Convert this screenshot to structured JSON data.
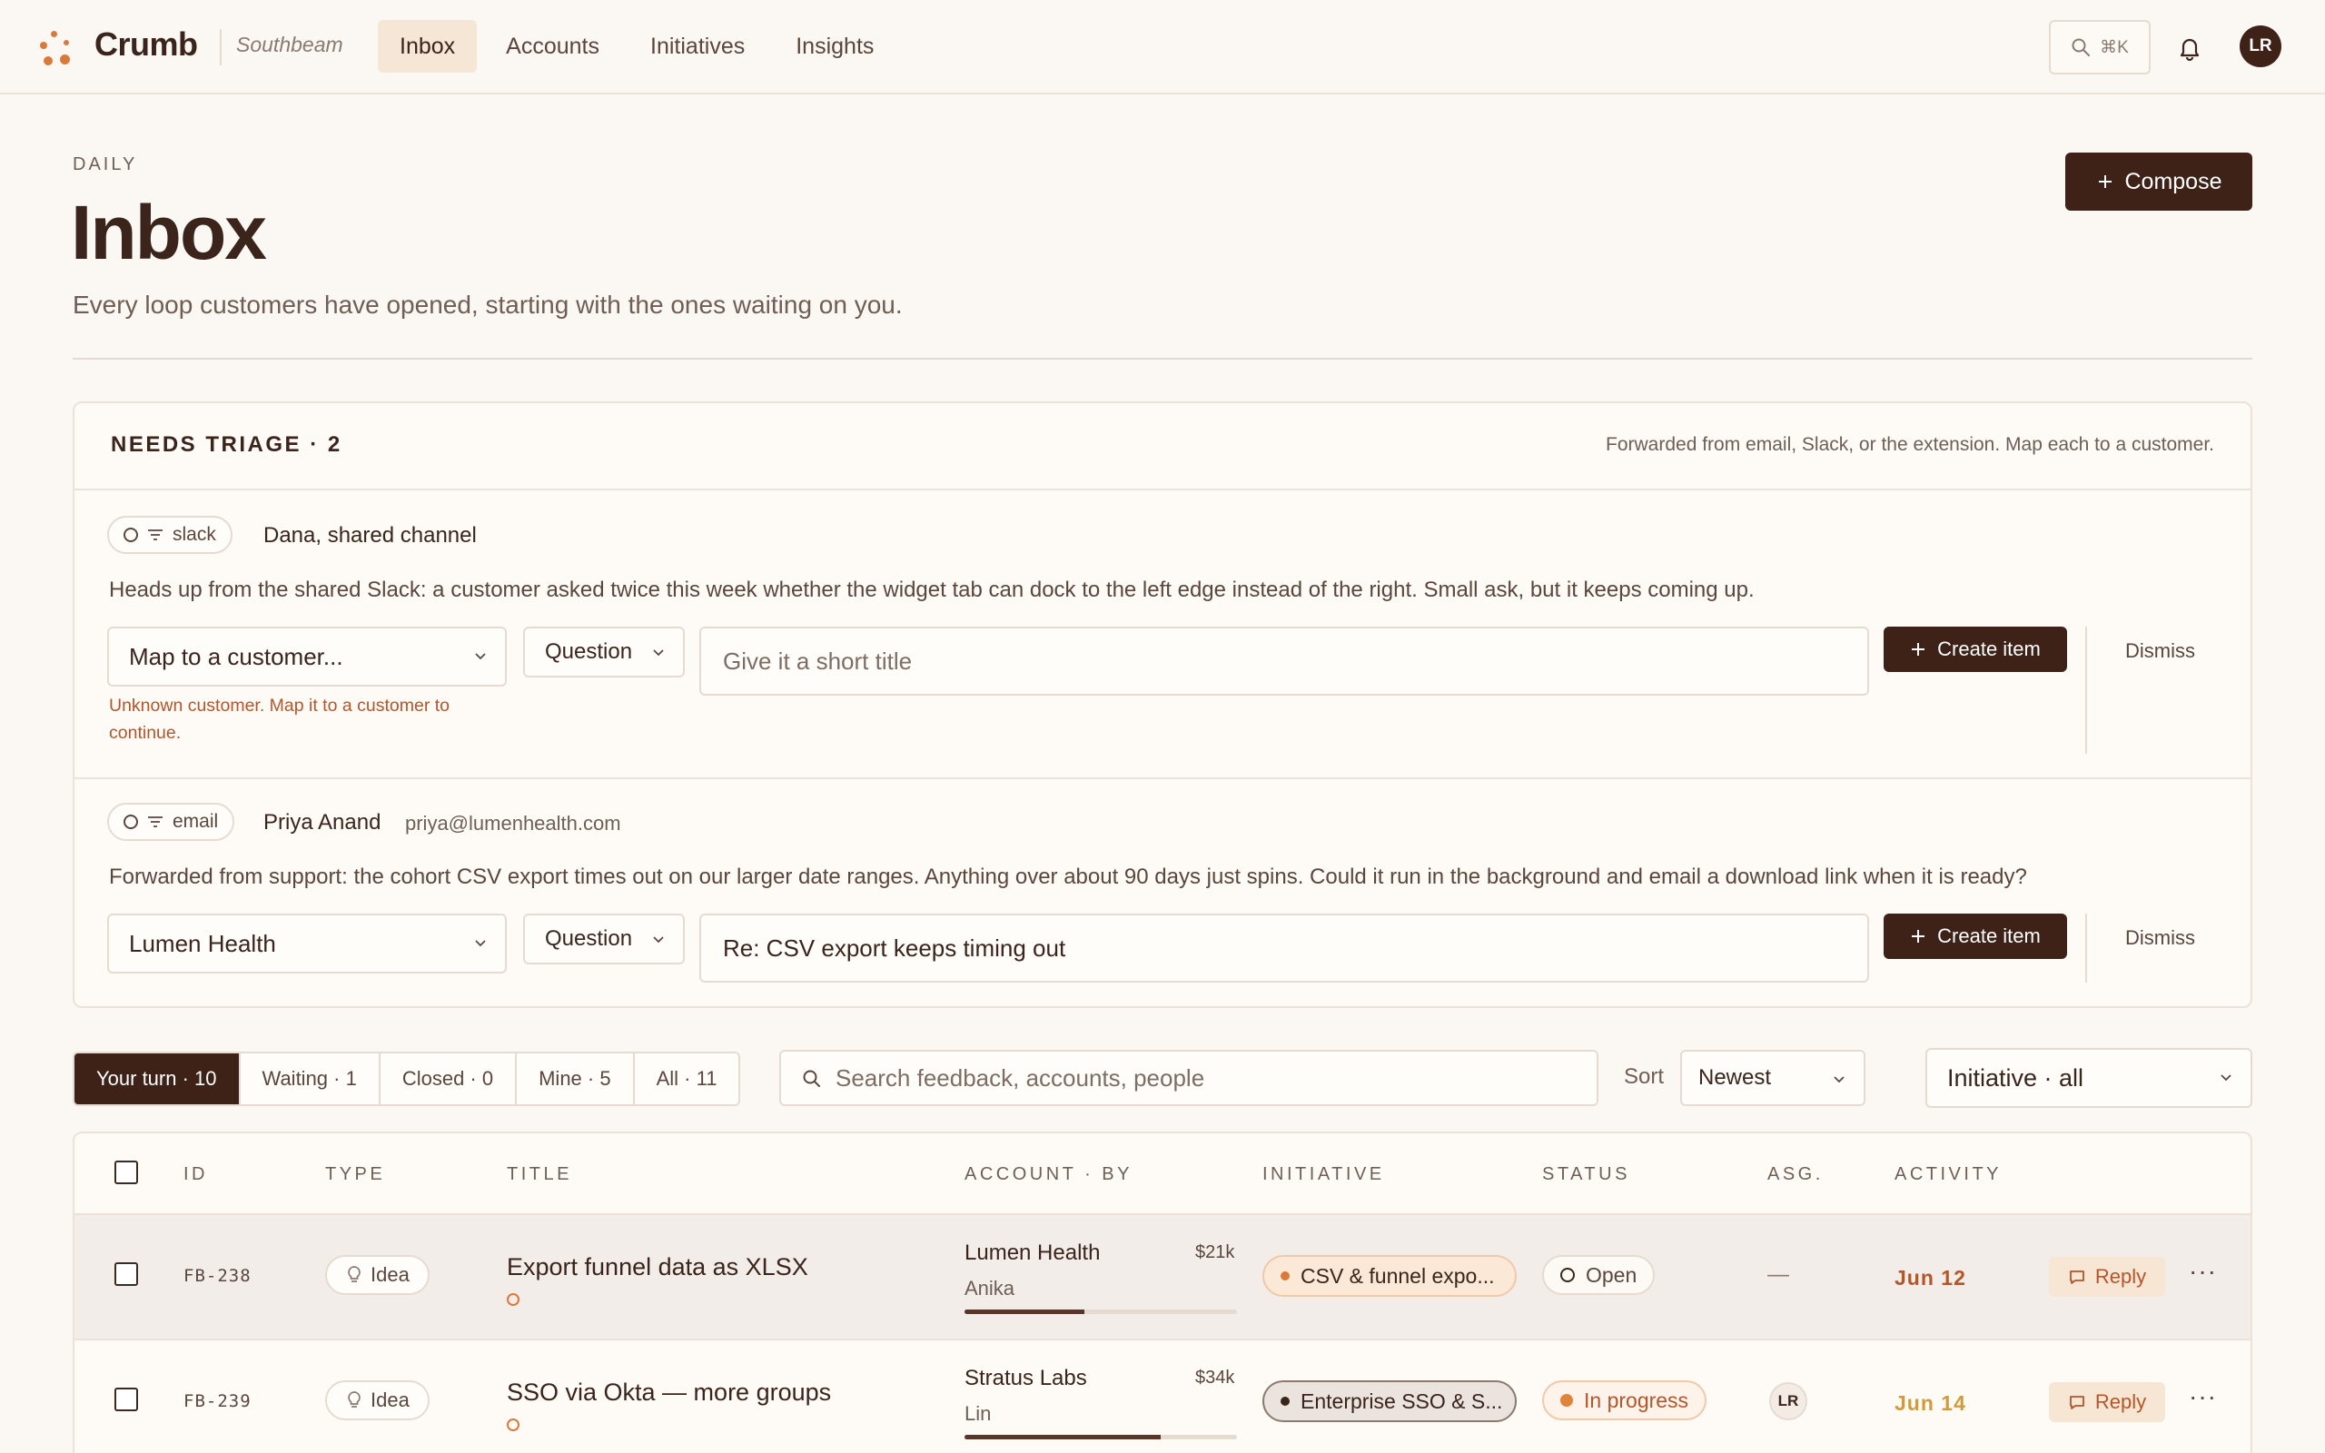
{
  "header": {
    "brand": "Crumb",
    "workspace": "Southbeam",
    "nav": [
      "Inbox",
      "Accounts",
      "Initiatives",
      "Insights"
    ],
    "active_nav": "Inbox",
    "search_shortcut": "⌘K",
    "avatar_initials": "LR",
    "icons": [
      "search-icon",
      "bell-icon"
    ]
  },
  "page": {
    "eyebrow": "DAILY",
    "title": "Inbox",
    "subtitle": "Every loop customers have opened, starting with the ones waiting on you.",
    "compose_label": "Compose"
  },
  "triage": {
    "title": "NEEDS TRIAGE · 2",
    "note": "Forwarded from email, Slack, or the extension. Map each to a customer.",
    "items": [
      {
        "source": "slack",
        "sender": "Dana, shared channel",
        "sender_email": "",
        "message": "Heads up from the shared Slack: a customer asked twice this week whether the widget tab can dock to the left edge instead of the right. Small ask, but it keeps coming up.",
        "customer": "Map to a customer...",
        "type": "Question",
        "title_value": "",
        "title_placeholder": "Give it a short title",
        "create_label": "Create item",
        "dismiss_label": "Dismiss",
        "error": "Unknown customer. Map it to a customer to continue."
      },
      {
        "source": "email",
        "sender": "Priya Anand",
        "sender_email": "priya@lumenhealth.com",
        "message": "Forwarded from support: the cohort CSV export times out on our larger date ranges. Anything over about 90 days just spins. Could it run in the background and email a download link when it is ready?",
        "customer": "Lumen Health",
        "type": "Question",
        "title_value": "Re: CSV export keeps timing out",
        "title_placeholder": "",
        "create_label": "Create item",
        "dismiss_label": "Dismiss"
      }
    ]
  },
  "filters": {
    "tabs": [
      "Your turn · 10",
      "Waiting · 1",
      "Closed · 0",
      "Mine · 5",
      "All · 11"
    ],
    "active_tab": "Your turn · 10",
    "search_placeholder": "Search feedback, accounts, people",
    "sort_label": "Sort",
    "sort_value": "Newest",
    "initiative_value": "Initiative · all"
  },
  "table": {
    "headers": [
      "ID",
      "TYPE",
      "TITLE",
      "ACCOUNT · BY",
      "INITIATIVE",
      "STATUS",
      "ASG.",
      "ACTIVITY"
    ],
    "rows": [
      {
        "id": "FB-238",
        "type": "Idea",
        "title": "Export funnel data as XLSX",
        "account": "Lumen Health",
        "amount": "$21k",
        "by": "Anika",
        "bar_fraction": 0.44,
        "initiative": "CSV & funnel expo...",
        "initiative_color": "#d97a3a",
        "status": "Open",
        "assignee": "—",
        "activity": "Jun 12",
        "activity_color": "#b4552a",
        "reply_label": "Reply"
      },
      {
        "id": "FB-239",
        "type": "Idea",
        "title": "SSO via Okta — more groups",
        "account": "Stratus Labs",
        "amount": "$34k",
        "by": "Lin",
        "bar_fraction": 0.72,
        "initiative": "Enterprise SSO & S...",
        "initiative_color": "#3a241b",
        "status": "In progress",
        "assignee": "LR",
        "activity": "Jun 14",
        "activity_color": "#d19a3a",
        "reply_label": "Reply"
      }
    ]
  },
  "colors": {
    "primary": "#3e2218",
    "accent": "#d97a3a",
    "background": "#fbf7f2",
    "error": "#b4552a"
  }
}
